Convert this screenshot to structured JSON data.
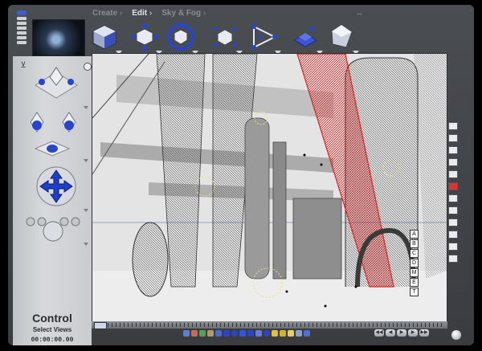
{
  "menu": {
    "create": "Create",
    "edit": "Edit",
    "sky_fog": "Sky & Fog"
  },
  "top_tools": [
    {
      "name": "object-create-tool-icon"
    },
    {
      "name": "move-object-tool-icon"
    },
    {
      "name": "rotate-object-tool-icon"
    },
    {
      "name": "scale-object-tool-icon"
    },
    {
      "name": "lathe-tool-icon"
    },
    {
      "name": "terrain-grid-tool-icon"
    },
    {
      "name": "glass-cube-tool-icon"
    }
  ],
  "left_panel": {
    "title": "Control",
    "subtitle": "Select Views",
    "timecode": "00:00:00.00"
  },
  "view_nav_labels": [
    "A",
    "B",
    "C",
    "D",
    "M",
    "E",
    "T"
  ],
  "colors": {
    "accent_blue": "#2a46c8",
    "wire_red": "#e02020",
    "wire_dark": "#3a3a3a",
    "light_yellow": "#e8e07a"
  }
}
